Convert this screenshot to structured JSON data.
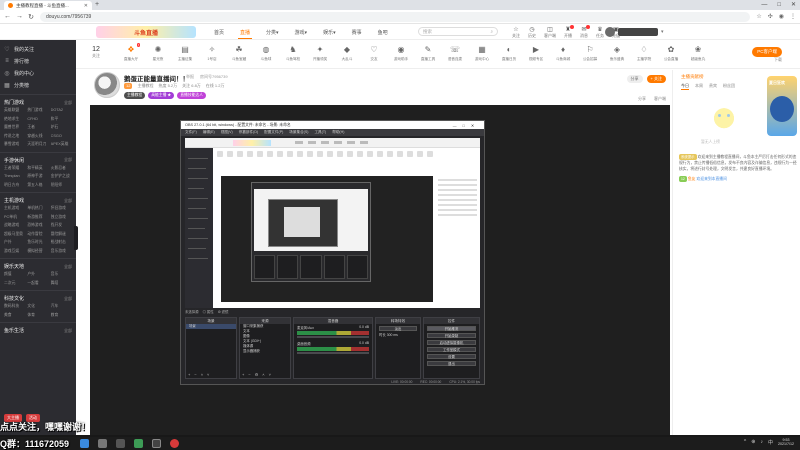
{
  "browser": {
    "tab_title": "主播教程直播 - 斗鱼直播...",
    "url": "douyu.com/7956739",
    "new_tab": "+",
    "window_controls": [
      "—",
      "□",
      "✕"
    ]
  },
  "site": {
    "logo_text": "斗鱼直播",
    "nav": [
      "首页",
      "直播",
      "分类▾",
      "游戏▾",
      "娱乐▾",
      "赛事",
      "鱼吧"
    ],
    "active_nav_index": 1,
    "search_placeholder": "搜索",
    "header_icons": [
      {
        "icon": "☆",
        "label": "关注"
      },
      {
        "icon": "◷",
        "label": "历史"
      },
      {
        "icon": "◫",
        "label": "客户端"
      },
      {
        "icon": "♜",
        "label": "开播"
      },
      {
        "icon": "✉",
        "label": "消息"
      },
      {
        "icon": "♛",
        "label": "任务"
      },
      {
        "icon": "▣",
        "label": "充值"
      }
    ]
  },
  "sidebar": {
    "top": [
      "我的关注",
      "排行榜",
      "我的中心",
      "分类榜"
    ],
    "sections": [
      {
        "title": "热门游戏",
        "more": "全部",
        "items": [
          "英雄联盟",
          "热门游戏",
          "DOTA2",
          "绝地求生",
          "CFHD",
          "和平",
          "魔兽世界",
          "王者",
          "炉石",
          "传说之地",
          "穿越火线",
          "CSGO",
          "暴雪游戏",
          "天涯明月刀",
          "APEX英雄"
        ]
      },
      {
        "title": "手游休闲",
        "more": "全部",
        "items": [
          "王者荣耀",
          "和平精英",
          "火影忍者",
          "Thespian",
          "原神手游",
          "金铲铲之战",
          "明日方舟",
          "第五人格",
          "阴阳师"
        ]
      },
      {
        "title": "主机游戏",
        "more": "全部",
        "items": [
          "主机游戏",
          "单机热门",
          "怀旧游戏",
          "PC单机",
          "新游推荐",
          "独立游戏",
          "战略游戏",
          "恐怖游戏",
          "找开发",
          "超级马里奥",
          "动作冒险",
          "冒险解谜",
          "户外",
          "鱼乐时光",
          "枪战射击",
          "游戏互娱",
          "模拟经营",
          "音乐游戏"
        ]
      },
      {
        "title": "娱乐天地",
        "more": "全部",
        "items": [
          "颜值",
          "户外",
          "音乐",
          "二次元",
          "一起看",
          "舞蹈"
        ]
      },
      {
        "title": "科技文化",
        "more": "全部",
        "items": [
          "数码科技",
          "文化",
          "汽车",
          "美食",
          "体育",
          "教育"
        ]
      },
      {
        "title": "鱼乐生活",
        "more": "全部",
        "items": []
      }
    ],
    "footer": [
      "大主播",
      "活动"
    ]
  },
  "category_bar": {
    "count": "12",
    "count_label": "关注",
    "items": [
      {
        "icon": "❖",
        "label": "直播大厅",
        "badge": "!"
      },
      {
        "icon": "✺",
        "label": "星光夜"
      },
      {
        "icon": "▤",
        "label": "主播征集"
      },
      {
        "icon": "✧",
        "label": "1号店"
      },
      {
        "icon": "☘",
        "label": "斗鱼宝藏"
      },
      {
        "icon": "◍",
        "label": "斗鱼球"
      },
      {
        "icon": "♞",
        "label": "斗鱼驾校"
      },
      {
        "icon": "✦",
        "label": "开播领奖"
      },
      {
        "icon": "◆",
        "label": "大乱斗"
      },
      {
        "icon": "♡",
        "label": "交友"
      },
      {
        "icon": "◉",
        "label": "游戏助手"
      },
      {
        "icon": "✎",
        "label": "直播工具"
      },
      {
        "icon": "☏",
        "label": "语音连麦"
      },
      {
        "icon": "▦",
        "label": "游戏中心"
      },
      {
        "icon": "◐",
        "label": "直播日历"
      },
      {
        "icon": "▶",
        "label": "视频专区"
      },
      {
        "icon": "♦",
        "label": "斗鱼商城"
      },
      {
        "icon": "⚐",
        "label": "公会招募"
      },
      {
        "icon": "◈",
        "label": "鱼乐盛典"
      },
      {
        "icon": "♢",
        "label": "主播学院"
      },
      {
        "icon": "✿",
        "label": "公会直播"
      },
      {
        "icon": "❀",
        "label": "超级鱼丸"
      }
    ],
    "pc_button": "PC客户端",
    "pc_sub": "下载"
  },
  "room": {
    "title": "鹅蛋正能量直播间！！",
    "tag1": "举报",
    "tag2": "房间号7956739",
    "level": "12",
    "meta": [
      "主播教程",
      "热度 5.2万",
      "关注 6.8万",
      "在线 1.2万"
    ],
    "tags": [
      "主播教程",
      "高能主播 ★",
      "直播技能达人"
    ],
    "report": "分享",
    "follow": "+ 关注",
    "right_meta": [
      "分享",
      "客户端"
    ]
  },
  "obs": {
    "title": "OBS 27.0.1 (64 bit, windows) - 配置文件: 未命名 - 场景: 未命名",
    "window_buttons": [
      "—",
      "□",
      "✕"
    ],
    "menu": [
      "文件(F)",
      "编辑(E)",
      "视图(V)",
      "停靠部件(D)",
      "配置文件(P)",
      "场景集合(S)",
      "工具(T)",
      "帮助(H)"
    ],
    "status_line": [
      "未选择源",
      "◎ 属性",
      "⚙ 滤镜"
    ],
    "scenes_title": "场景",
    "scenes": [
      "场景"
    ],
    "sources_title": "来源",
    "sources": [
      "窗口采集捕获",
      "文本",
      "图像",
      "文本 (GDI+)",
      "媒体源",
      "显示器捕获"
    ],
    "mixer_title": "混音器",
    "channels": [
      {
        "name": "麦克风/Aux",
        "db": "0.0 dB"
      },
      {
        "name": "桌面音频",
        "db": "0.0 dB"
      }
    ],
    "transitions_title": "转场特效",
    "transition_value": "淡出",
    "duration_label": "时长",
    "duration_value": "300 ms",
    "controls_title": "控件",
    "controls": [
      "开始推流",
      "开始录制",
      "启动虚拟摄像机",
      "工作室模式",
      "设置",
      "退出"
    ],
    "bottom": [
      "LIVE: 00:00:00",
      "REC: 00:00:00",
      "CPU: 2.1%, 30.00 fps"
    ]
  },
  "right_panel": {
    "header": "主播贡献榜",
    "tabs": [
      "今日",
      "本周",
      "贵宾",
      "粉丝团"
    ],
    "empty_caption": "暂无人上榜",
    "promo_title": "夏日狂欢",
    "chat": [
      {
        "badge": "系统提示",
        "text": "欢迎来到主播教程直播间，斗鱼本主严厉打击任何形式的违规行为，禁止传播低俗信息，发布不良内容及诈骗信息，违规行为一经核实，将进行封号处理，文明发言，共建良好直播环境。"
      },
      {
        "badge": "12",
        "user": "鱼友",
        "text": "欢迎来到本直播间"
      }
    ]
  },
  "stream_overlay": {
    "line1": "点点关注，嘿嘿谢谢！",
    "line2": "Q群：111672059"
  },
  "taskbar": {
    "icons": [
      "windows-start",
      "search",
      "taskview",
      "browser",
      "obs",
      "record"
    ],
    "time": "9:53",
    "date": "2021/7/12",
    "tray": [
      "^",
      "⊕",
      "♪",
      "中"
    ]
  }
}
